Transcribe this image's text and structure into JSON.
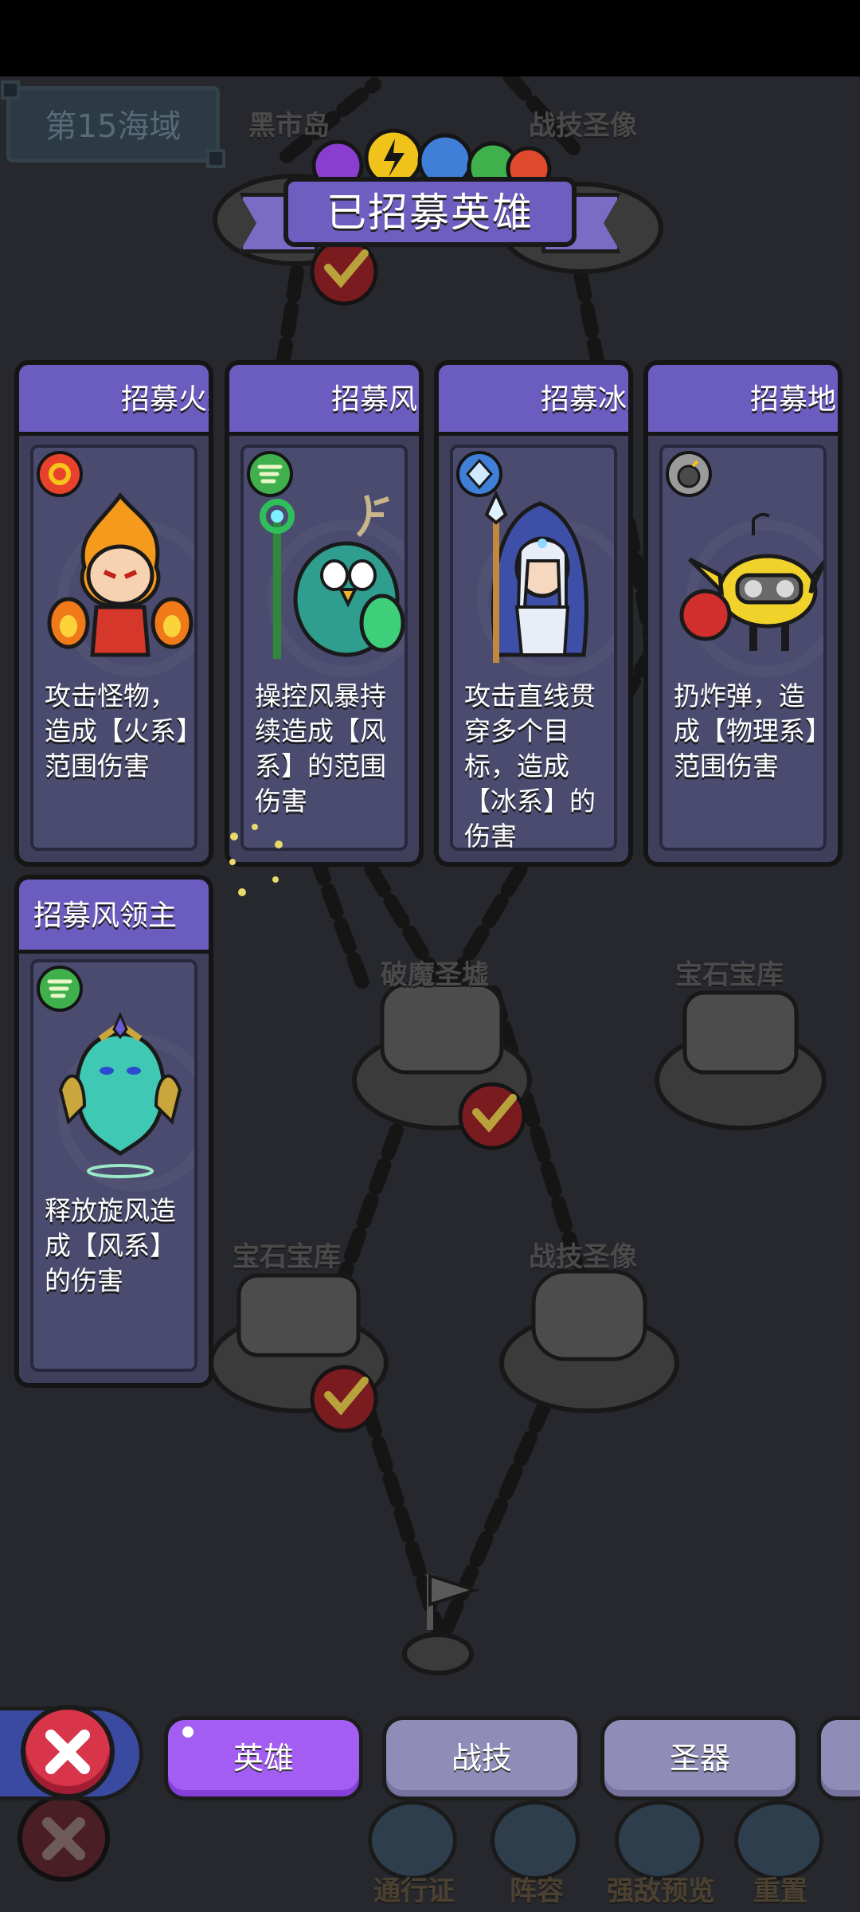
{
  "map": {
    "sea_label": "第15海域",
    "nodes": [
      "黑市岛",
      "战技圣像",
      "破魔圣墟",
      "宝石宝库",
      "宝石宝库",
      "战技圣像"
    ]
  },
  "banner": {
    "title": "已招募英雄"
  },
  "cards": [
    {
      "title": "招募火焰",
      "element": "fire",
      "desc": "攻击怪物，造成【火系】范围伤害"
    },
    {
      "title": "招募风系",
      "element": "wind",
      "desc": "操控风暴持续造成【风系】的范围伤害"
    },
    {
      "title": "招募冰霜",
      "element": "ice",
      "desc": "攻击直线贯穿多个目标，造成【冰系】的伤害"
    },
    {
      "title": "招募地系",
      "element": "physical",
      "desc": "扔炸弹，造成【物理系】范围伤害"
    },
    {
      "title": "招募风领主",
      "element": "wind",
      "desc": "释放旋风造成【风系】的伤害"
    }
  ],
  "tabs": {
    "hero": "英雄",
    "skill": "战技",
    "artifact": "圣器"
  },
  "nav": {
    "pass": "通行证",
    "lineup": "阵容",
    "preview": "强敌预览",
    "reset": "重置"
  },
  "colors": {
    "accent": "#6b5cbf",
    "tab_active": "#a35df2",
    "tab_idle": "#8f8db7",
    "close": "#d8344a"
  }
}
